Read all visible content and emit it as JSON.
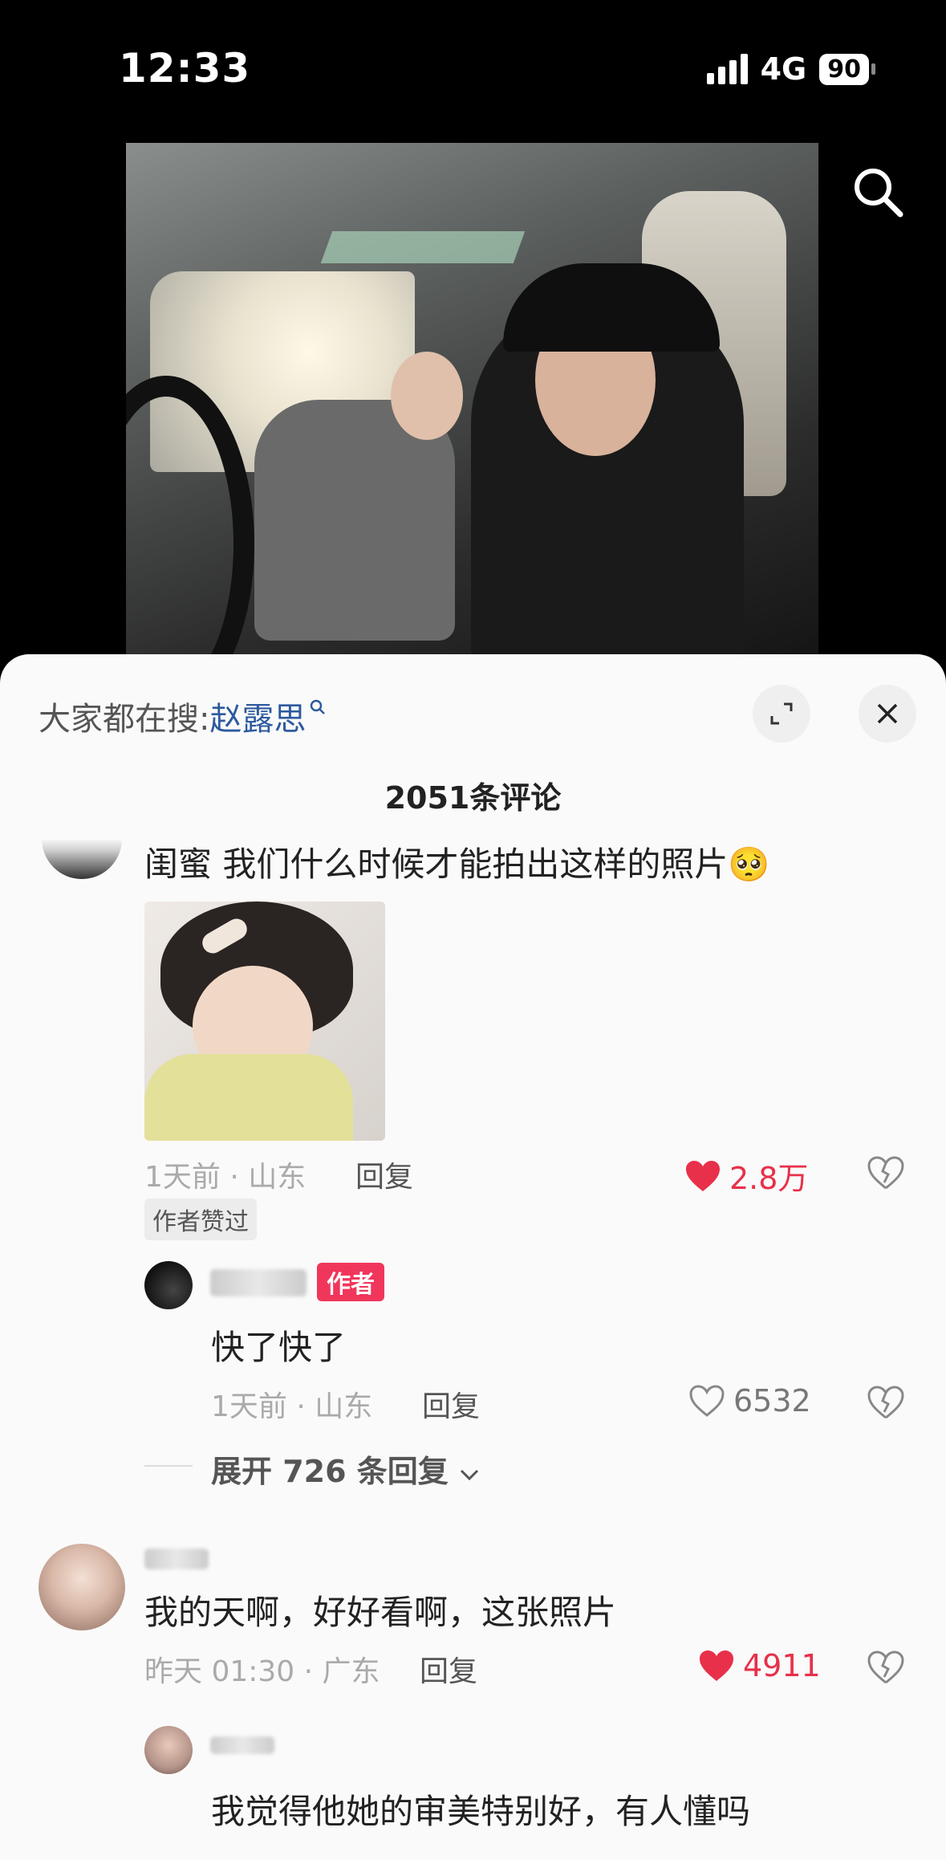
{
  "status_bar": {
    "time": "12:33",
    "network": "4G",
    "battery": "90"
  },
  "sheet": {
    "hot_search_label": "大家都在搜:",
    "hot_search_term": "赵露思",
    "comment_count": "2051条评论"
  },
  "comments": [
    {
      "text": "闺蜜  我们什么时候才能拍出这样的照片🥺",
      "time_location": "1天前 · 山东",
      "reply_label": "回复",
      "likes": "2.8万",
      "author_liked_tag": "作者赞过",
      "replies": [
        {
          "badge": "作者",
          "text": "快了快了",
          "time_location": "1天前 · 山东",
          "reply_label": "回复",
          "likes": "6532"
        }
      ],
      "expand_label": "展开 726 条回复"
    },
    {
      "text": "我的天啊，好好看啊，这张照片",
      "time_location": "昨天 01:30 · 广东",
      "reply_label": "回复",
      "likes": "4911",
      "replies": [
        {
          "text": "我觉得他她的审美特别好，有人懂吗"
        }
      ]
    }
  ],
  "colors": {
    "accent_red": "#e8304a",
    "link_blue": "#2d5a9e",
    "author_badge": "#f0365b"
  },
  "icons": [
    "search-icon",
    "expand-icon",
    "close-icon",
    "heart-icon",
    "broken-heart-icon",
    "chevron-down-icon"
  ]
}
